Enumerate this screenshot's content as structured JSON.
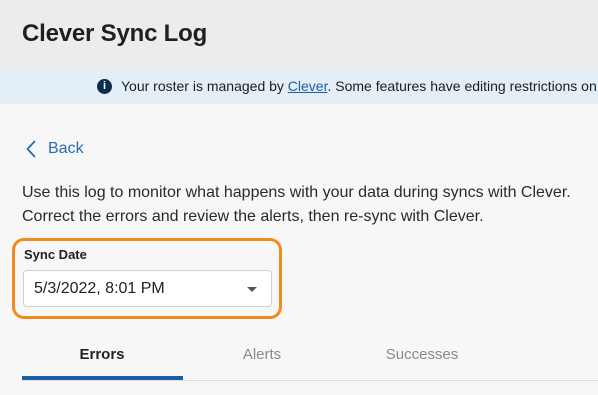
{
  "header": {
    "title": "Clever Sync Log"
  },
  "banner": {
    "icon": "info-icon",
    "text_before": "Your roster is managed by ",
    "link_text": "Clever",
    "text_after": ". Some features have editing restrictions on"
  },
  "nav": {
    "back_label": "Back",
    "back_icon": "chevron-left-icon"
  },
  "description": {
    "line1": "Use this log to monitor what happens with your data during syncs with Clever.",
    "line2": "Correct the errors and review the alerts, then re-sync with Clever."
  },
  "sync_date": {
    "label": "Sync Date",
    "selected_value": "5/3/2022, 8:01 PM",
    "highlight_color": "#f28a1e"
  },
  "tabs": [
    {
      "label": "Errors",
      "active": true
    },
    {
      "label": "Alerts",
      "active": false
    },
    {
      "label": "Successes",
      "active": false
    }
  ],
  "colors": {
    "accent": "#1b5ea8",
    "link": "#2b6cb0",
    "banner_bg": "#e3eef7"
  }
}
